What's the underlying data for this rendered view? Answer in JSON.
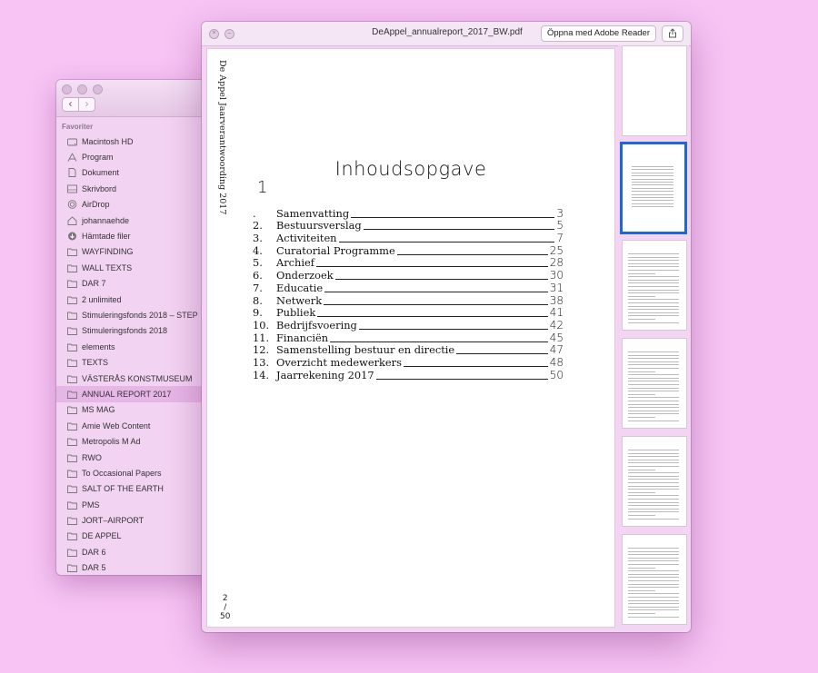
{
  "finder": {
    "nav": {
      "back": "‹",
      "forward": "›"
    },
    "section_heading": "Favoriter",
    "items": [
      {
        "label": "Macintosh HD",
        "icon": "hard-drive-icon"
      },
      {
        "label": "Program",
        "icon": "applications-icon"
      },
      {
        "label": "Dokument",
        "icon": "document-icon"
      },
      {
        "label": "Skrivbord",
        "icon": "desktop-icon"
      },
      {
        "label": "AirDrop",
        "icon": "airdrop-icon"
      },
      {
        "label": "johannaehde",
        "icon": "home-icon"
      },
      {
        "label": "Hämtade filer",
        "icon": "download-icon"
      },
      {
        "label": "WAYFINDING",
        "icon": "folder-icon"
      },
      {
        "label": "WALL TEXTS",
        "icon": "folder-icon"
      },
      {
        "label": "DAR 7",
        "icon": "folder-icon"
      },
      {
        "label": "2 unlimited",
        "icon": "folder-icon"
      },
      {
        "label": "Stimuleringsfonds 2018 – STEP",
        "icon": "folder-icon"
      },
      {
        "label": "Stimuleringsfonds 2018",
        "icon": "folder-icon"
      },
      {
        "label": "elements",
        "icon": "folder-icon"
      },
      {
        "label": "TEXTS",
        "icon": "folder-icon"
      },
      {
        "label": "VÄSTERÅS KONSTMUSEUM",
        "icon": "folder-icon"
      },
      {
        "label": "ANNUAL REPORT 2017",
        "icon": "folder-icon",
        "selected": true
      },
      {
        "label": "MS MAG",
        "icon": "folder-icon"
      },
      {
        "label": "Amie Web Content",
        "icon": "folder-icon"
      },
      {
        "label": "Metropolis M Ad",
        "icon": "folder-icon"
      },
      {
        "label": "RWO",
        "icon": "folder-icon"
      },
      {
        "label": "To Occasional Papers",
        "icon": "folder-icon"
      },
      {
        "label": "SALT OF THE EARTH",
        "icon": "folder-icon"
      },
      {
        "label": "PMS",
        "icon": "folder-icon"
      },
      {
        "label": "JORT–AIRPORT",
        "icon": "folder-icon"
      },
      {
        "label": "DE APPEL",
        "icon": "folder-icon"
      },
      {
        "label": "DAR 6",
        "icon": "folder-icon"
      },
      {
        "label": "DAR 5",
        "icon": "folder-icon"
      }
    ]
  },
  "preview": {
    "window_title": "DeAppel_annualreport_2017_BW.pdf",
    "open_button": "Öppna med Adobe Reader",
    "share_icon": "share-icon",
    "page": {
      "side_title": "De Appel Jaarverantwoording 2017",
      "toc_title": "Inhoudsopgave",
      "first_number_glyph": "1",
      "entries": [
        {
          "num": ".",
          "label": "Samenvatting",
          "page": "3"
        },
        {
          "num": "2.",
          "label": "Bestuursverslag",
          "page": "5"
        },
        {
          "num": "3.",
          "label": "Activiteiten",
          "page": "7"
        },
        {
          "num": "4.",
          "label": "Curatorial Programme",
          "page": "25"
        },
        {
          "num": "5.",
          "label": "Archief",
          "page": "28"
        },
        {
          "num": "6.",
          "label": "Onderzoek",
          "page": "30"
        },
        {
          "num": "7.",
          "label": "Educatie",
          "page": "31"
        },
        {
          "num": "8.",
          "label": "Netwerk",
          "page": "38"
        },
        {
          "num": "9.",
          "label": "Publiek",
          "page": "41"
        },
        {
          "num": "10.",
          "label": "Bedrijfsvoering",
          "page": "42"
        },
        {
          "num": "11.",
          "label": "Financiën",
          "page": "45"
        },
        {
          "num": "12.",
          "label": "Samenstelling bestuur en directie",
          "page": "47"
        },
        {
          "num": "13.",
          "label": "Overzicht medewerkers",
          "page": "48"
        },
        {
          "num": "14.",
          "label": "Jaarrekening 2017",
          "page": "50"
        }
      ],
      "page_current": "2",
      "page_sep": "/",
      "page_total": "50"
    },
    "selected_thumbnail_color": "#1f66d6"
  }
}
